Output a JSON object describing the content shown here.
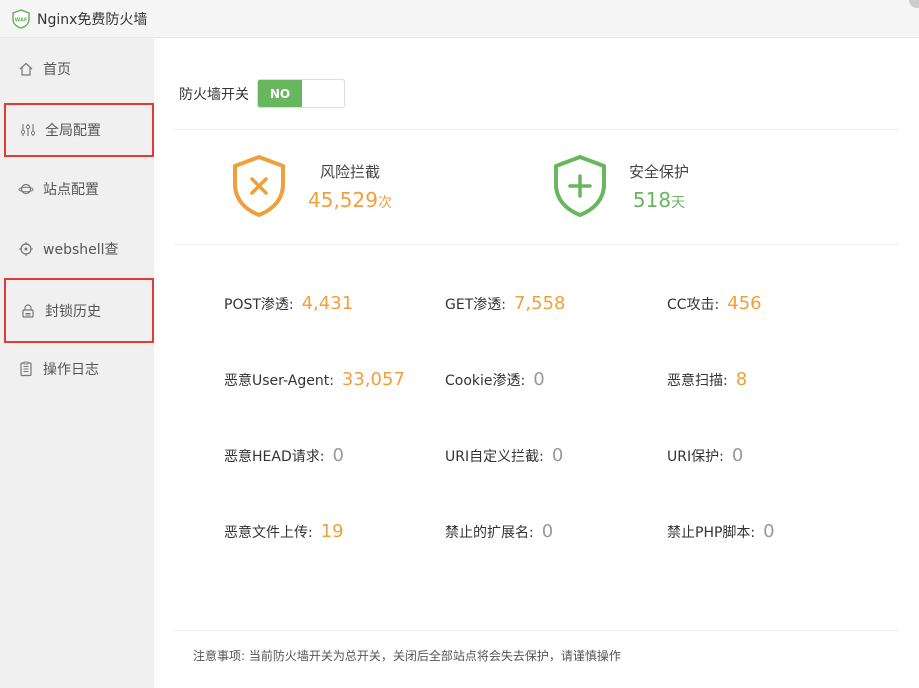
{
  "app": {
    "title": "Nginx免费防火墙"
  },
  "sidebar": {
    "items": [
      {
        "label": "首页"
      },
      {
        "label": "全局配置"
      },
      {
        "label": "站点配置"
      },
      {
        "label": "webshell查"
      },
      {
        "label": "封锁历史"
      },
      {
        "label": "操作日志"
      }
    ]
  },
  "firewall": {
    "switch_label": "防火墙开关",
    "switch_state": "NO"
  },
  "summary": {
    "risk": {
      "label": "风险拦截",
      "value": "45,529",
      "unit": "次"
    },
    "safe": {
      "label": "安全保护",
      "value": "518",
      "unit": "天"
    }
  },
  "metrics": [
    {
      "label": "POST渗透:",
      "value": "4,431"
    },
    {
      "label": "GET渗透:",
      "value": "7,558"
    },
    {
      "label": "CC攻击:",
      "value": "456"
    },
    {
      "label": "恶意User-Agent:",
      "value": "33,057"
    },
    {
      "label": "Cookie渗透:",
      "value": "0"
    },
    {
      "label": "恶意扫描:",
      "value": "8"
    },
    {
      "label": "恶意HEAD请求:",
      "value": "0"
    },
    {
      "label": "URI自定义拦截:",
      "value": "0"
    },
    {
      "label": "URI保护:",
      "value": "0"
    },
    {
      "label": "恶意文件上传:",
      "value": "19"
    },
    {
      "label": "禁止的扩展名:",
      "value": "0"
    },
    {
      "label": "禁止PHP脚本:",
      "value": "0"
    }
  ],
  "notice": "注意事项: 当前防火墙开关为总开关，关闭后全部站点将会失去保护，请谨慎操作",
  "colors": {
    "accent_green": "#68b65e",
    "warning_orange": "#f0a03a",
    "zero_gray": "#999999",
    "highlight_red": "#e53935"
  }
}
